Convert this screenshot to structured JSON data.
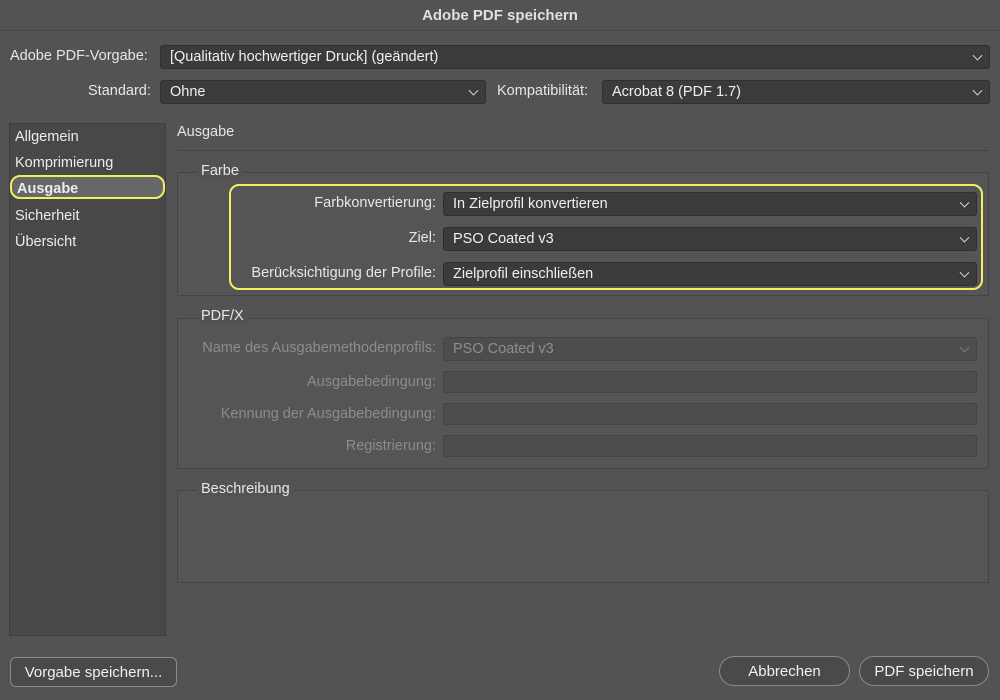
{
  "window": {
    "title": "Adobe PDF speichern"
  },
  "preset": {
    "label": "Adobe PDF-Vorgabe:",
    "value": "[Qualitativ hochwertiger Druck] (geändert)"
  },
  "standard": {
    "label": "Standard:",
    "value": "Ohne"
  },
  "compat": {
    "label": "Kompatibilität:",
    "value": "Acrobat 8 (PDF 1.7)"
  },
  "sidebar": {
    "items": [
      {
        "label": "Allgemein"
      },
      {
        "label": "Komprimierung"
      },
      {
        "label": "Ausgabe",
        "active": true
      },
      {
        "label": "Sicherheit"
      },
      {
        "label": "Übersicht"
      }
    ]
  },
  "panel": {
    "title": "Ausgabe"
  },
  "farbe": {
    "title": "Farbe",
    "conversion": {
      "label": "Farbkonvertierung:",
      "value": "In Zielprofil konvertieren"
    },
    "target": {
      "label": "Ziel:",
      "value": "PSO Coated v3"
    },
    "profiles": {
      "label": "Berücksichtigung der Profile:",
      "value": "Zielprofil einschließen"
    }
  },
  "pdfx": {
    "title": "PDF/X",
    "profile_name": {
      "label": "Name des Ausgabemethodenprofils:",
      "value": "PSO Coated v3"
    },
    "condition": {
      "label": "Ausgabebedingung:",
      "value": ""
    },
    "condition_id": {
      "label": "Kennung der Ausgabebedingung:",
      "value": ""
    },
    "registry": {
      "label": "Registrierung:",
      "value": ""
    }
  },
  "description": {
    "title": "Beschreibung"
  },
  "buttons": {
    "save_preset": "Vorgabe speichern...",
    "cancel": "Abbrechen",
    "save_pdf": "PDF speichern"
  },
  "colors": {
    "highlight": "#f2ee64",
    "background": "#535353"
  }
}
